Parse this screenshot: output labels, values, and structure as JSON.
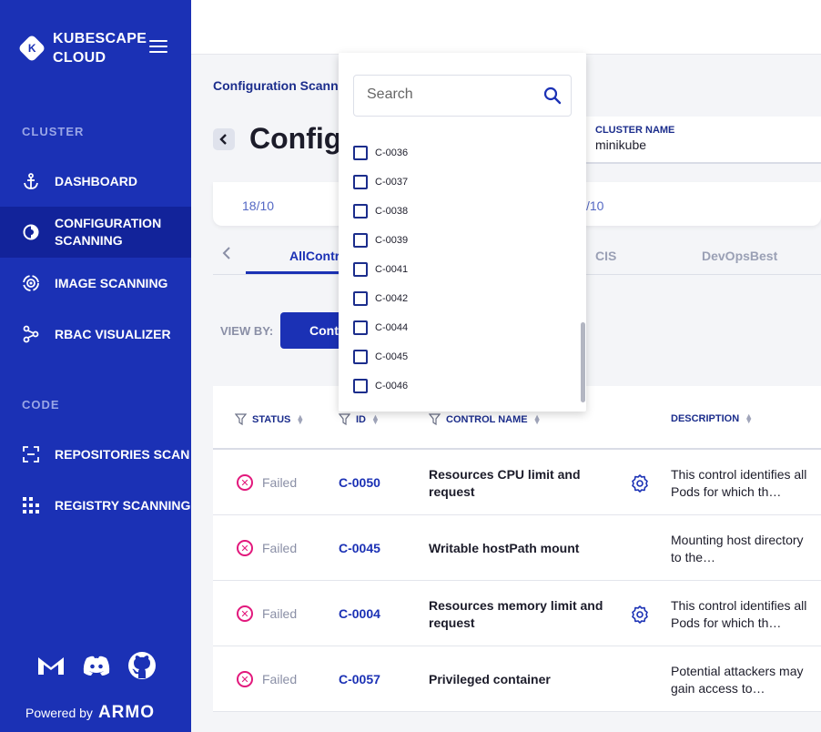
{
  "sidebar": {
    "logo_letter": "K",
    "logo_line1": "KUBESCAPE",
    "logo_line2": "CLOUD",
    "section_cluster": "CLUSTER",
    "section_code": "CODE",
    "items": [
      {
        "label": "DASHBOARD",
        "icon": "anchor-icon"
      },
      {
        "label": "CONFIGURATION SCANNING",
        "icon": "config-scan-icon",
        "active": true
      },
      {
        "label": "IMAGE SCANNING",
        "icon": "image-scan-icon"
      },
      {
        "label": "RBAC VISUALIZER",
        "icon": "rbac-icon"
      },
      {
        "label": "REPOSITORIES SCAN",
        "icon": "repo-scan-icon"
      },
      {
        "label": "REGISTRY SCANNING",
        "icon": "registry-icon"
      }
    ],
    "powered_by": "Powered by",
    "brand": "ARMO"
  },
  "header": {
    "breadcrumb": "Configuration Scanni",
    "title": "Configu",
    "cluster_label": "CLUSTER NAME",
    "cluster_value": "minikube",
    "date_left": "18/10",
    "date_right": "/10"
  },
  "tabs": [
    {
      "label": "AllContr",
      "active": true
    },
    {
      "label": "CIS"
    },
    {
      "label": "DevOpsBest"
    }
  ],
  "viewby": {
    "label": "VIEW BY:",
    "button": "Cont"
  },
  "table": {
    "headers": [
      "STATUS",
      "ID",
      "CONTROL NAME",
      "DESCRIPTION"
    ],
    "rows": [
      {
        "status": "Failed",
        "id": "C-0050",
        "name": "Resources CPU limit and request",
        "config": true,
        "desc": "This control identifies all Pods for which th…"
      },
      {
        "status": "Failed",
        "id": "C-0045",
        "name": "Writable hostPath mount",
        "config": false,
        "desc": "Mounting host directory to the…"
      },
      {
        "status": "Failed",
        "id": "C-0004",
        "name": "Resources memory limit and request",
        "config": true,
        "desc": "This control identifies all Pods for which th…"
      },
      {
        "status": "Failed",
        "id": "C-0057",
        "name": "Privileged container",
        "config": false,
        "desc": "Potential attackers may gain access to…"
      }
    ]
  },
  "dropdown": {
    "search_placeholder": "Search",
    "options": [
      "C-0036",
      "C-0037",
      "C-0038",
      "C-0039",
      "C-0041",
      "C-0042",
      "C-0044",
      "C-0045",
      "C-0046"
    ]
  },
  "colors": {
    "primary": "#1b31b5",
    "failed": "#e2187c"
  }
}
